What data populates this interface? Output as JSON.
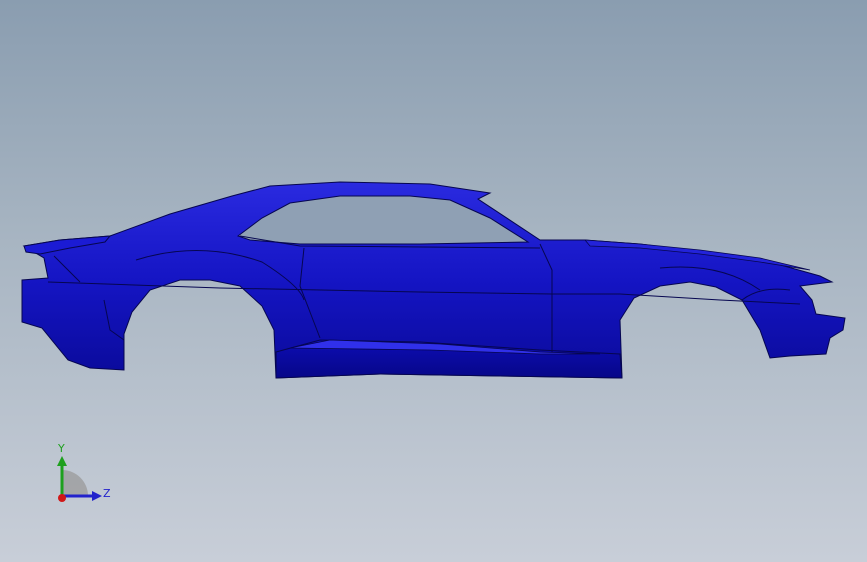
{
  "viewport": {
    "background_top": "#8a9db0",
    "background_bottom": "#c8ced8"
  },
  "model": {
    "body_color": "#1414c8",
    "edge_color": "#060650"
  },
  "triad": {
    "y_label": "Y",
    "z_label": "Z",
    "y_color": "#1ea01e",
    "z_color": "#2222cc",
    "x_color": "#d01818"
  }
}
